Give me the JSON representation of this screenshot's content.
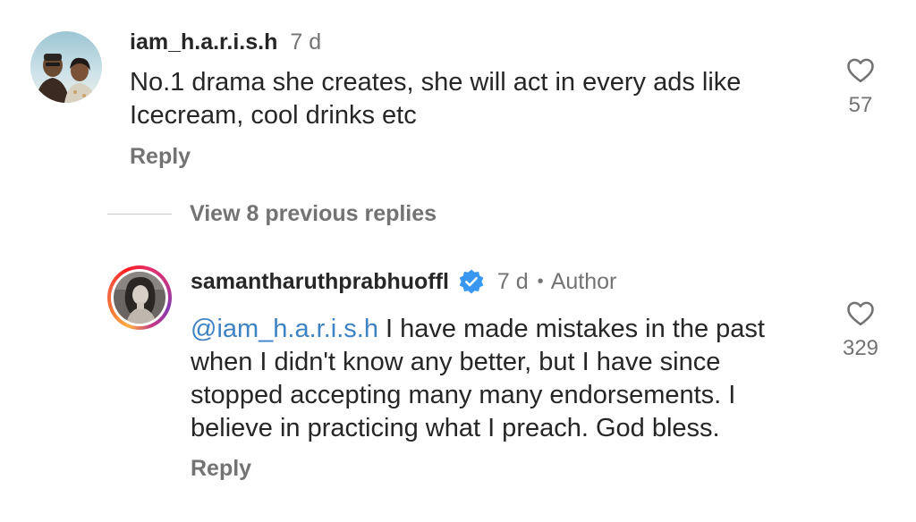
{
  "comments": [
    {
      "username": "iam_h.a.r.i.s.h",
      "time": "7 d",
      "text": "No.1 drama she creates, she will act in every ads like Icecream, cool drinks etc",
      "reply_label": "Reply",
      "likes": "57",
      "avatar_icon": "user-photo-avatar",
      "heart_icon": "heart-outline-icon"
    },
    {
      "username": "samantharuthprabhuoffl",
      "verified_icon": "verified-badge-icon",
      "time": "7 d",
      "separator": "•",
      "author_label": "Author",
      "mention": "@iam_h.a.r.i.s.h",
      "text": " I have made mistakes in the past when I didn't know any better, but I have since stopped accepting many many endorsements. I believe in practicing what I preach. God bless.",
      "reply_label": "Reply",
      "likes": "329",
      "avatar_icon": "story-ring-avatar",
      "heart_icon": "heart-outline-icon"
    }
  ],
  "view_replies": {
    "label": "View 8 previous replies"
  },
  "colors": {
    "text": "#262626",
    "secondary": "#737373",
    "mention": "#3d82c4",
    "verified": "#3897f0"
  }
}
